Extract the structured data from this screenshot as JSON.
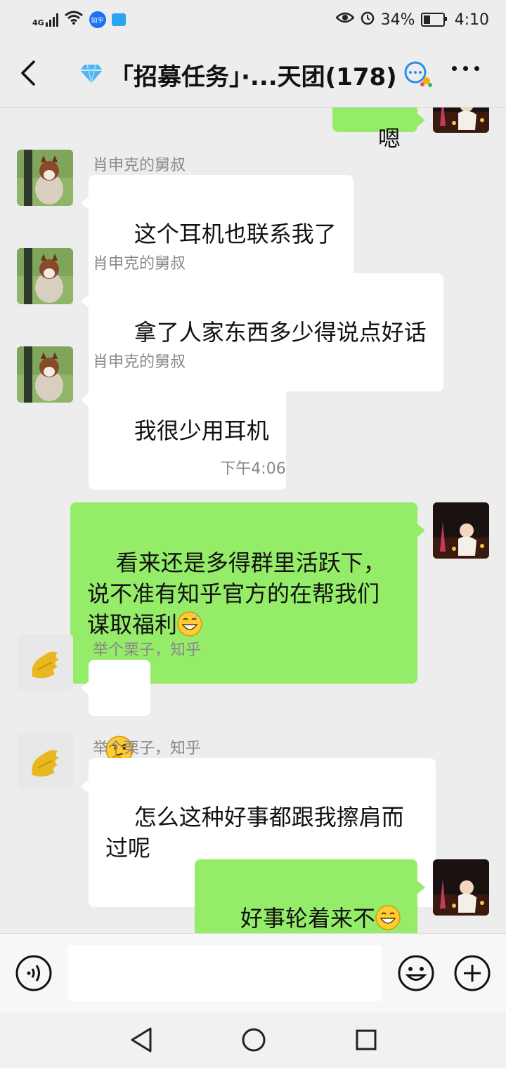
{
  "status_bar": {
    "network": "4G",
    "zhihu_badge": "知乎",
    "battery": "34%",
    "time": "4:10"
  },
  "header": {
    "title": "「招募任务」·...天团(178)"
  },
  "messages": [
    {
      "sender": "",
      "text": "嗯",
      "direction": "out"
    },
    {
      "sender": "肖申克的舅叔",
      "text": "这个耳机也联系我了",
      "direction": "in"
    },
    {
      "sender": "肖申克的舅叔",
      "text": "拿了人家东西多少得说点好话",
      "direction": "in"
    },
    {
      "sender": "肖申克的舅叔",
      "text": "我很少用耳机",
      "direction": "in"
    },
    {
      "timestamp": "下午4:06"
    },
    {
      "sender": "",
      "text": "看来还是多得群里活跃下，说不准有知乎官方的在帮我们谋取福利",
      "emoji": "grinning-sweat-emoji",
      "direction": "out"
    },
    {
      "sender": "举个栗子，知乎",
      "text": "",
      "emoji": "thinking-emoji",
      "direction": "in"
    },
    {
      "sender": "举个栗子，知乎",
      "text": "怎么这种好事都跟我擦肩而过呢",
      "direction": "in"
    },
    {
      "sender": "",
      "text": "好事轮着来不",
      "emoji": "grinning-emoji",
      "direction": "out"
    }
  ],
  "input_bar": {
    "placeholder": ""
  },
  "colors": {
    "background": "#ededed",
    "bubble_out": "#95ec69",
    "bubble_in": "#ffffff"
  }
}
